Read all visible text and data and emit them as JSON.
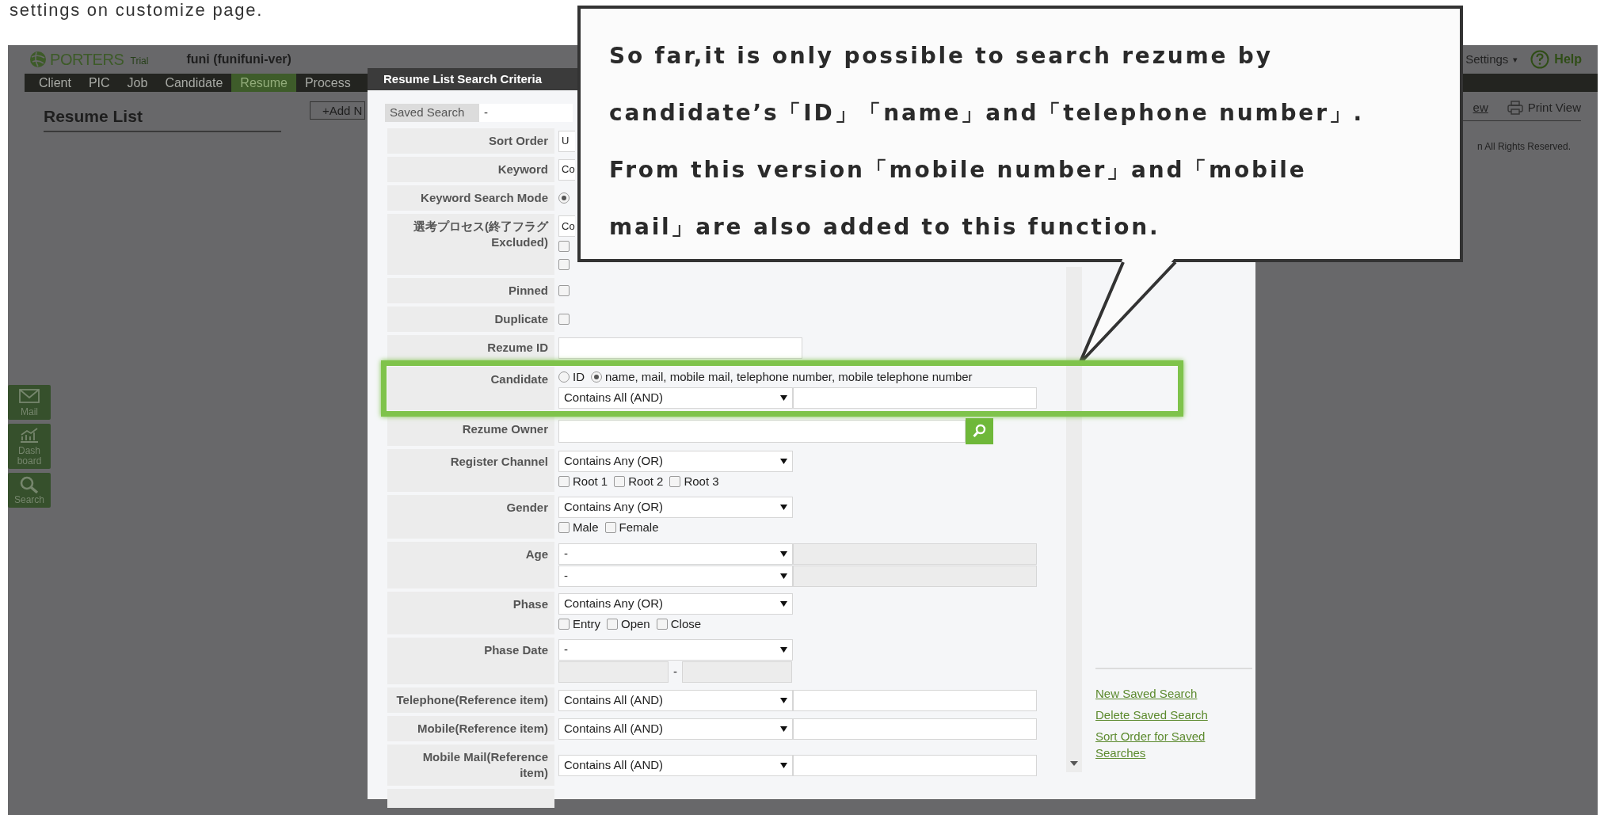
{
  "caption_top": "settings on customize page.",
  "app": {
    "logo": {
      "name": "PORTERS",
      "badge": "Trial"
    },
    "account": "funi (funifuni-ver)",
    "header_links": [
      {
        "kind": "settings",
        "label": "Settings",
        "caret": "▾"
      },
      {
        "kind": "help",
        "label": "Help"
      }
    ],
    "nav": [
      {
        "label": "Client",
        "selected": false
      },
      {
        "label": "PIC",
        "selected": false
      },
      {
        "label": "Job",
        "selected": false
      },
      {
        "label": "Candidate",
        "selected": false
      },
      {
        "label": "Resume",
        "selected": true
      },
      {
        "label": "Process",
        "selected": false
      }
    ],
    "page_title": "Resume List",
    "add_button": "+Add N",
    "view_links": [
      {
        "kind": "link",
        "label": "ew"
      },
      {
        "kind": "print",
        "label": "Print View"
      }
    ],
    "footer": "n All Rights Reserved.",
    "side_buttons": [
      {
        "kind": "mail",
        "label": "Mail"
      },
      {
        "kind": "dashboard",
        "label": "Dash\nboard"
      },
      {
        "kind": "search",
        "label": "Search"
      }
    ]
  },
  "dialog": {
    "title": "Resume List Search Criteria",
    "saved_search": {
      "label": "Saved Search",
      "value": "-"
    },
    "rows": [
      {
        "label": "Sort Order",
        "lines": [
          [
            {
              "kind": "partial_select",
              "value": "U"
            }
          ]
        ]
      },
      {
        "label": "Keyword",
        "lines": [
          [
            {
              "kind": "partial_select",
              "value": "Co"
            }
          ]
        ]
      },
      {
        "label": "Keyword Search Mode",
        "lines": [
          [
            {
              "kind": "radio",
              "selected": true
            }
          ]
        ]
      },
      {
        "label": "選考プロセス(終了フラグ Excluded)",
        "lines": [
          [
            {
              "kind": "partial_select",
              "value": "Co"
            }
          ],
          [
            {
              "kind": "checkbox",
              "checked": false
            }
          ],
          [
            {
              "kind": "checkbox",
              "checked": false
            }
          ]
        ]
      },
      {
        "label": "Pinned",
        "lines": [
          [
            {
              "kind": "checkbox",
              "checked": false
            }
          ]
        ]
      },
      {
        "label": "Duplicate",
        "lines": [
          [
            {
              "kind": "checkbox",
              "checked": false
            }
          ]
        ]
      },
      {
        "label": "Rezume ID",
        "lines": [
          [
            {
              "kind": "input",
              "disabled": false
            }
          ]
        ]
      },
      {
        "label": "Candidate",
        "highlighted": true,
        "lines": [
          [
            {
              "kind": "radio",
              "label": "ID",
              "selected": false
            },
            {
              "kind": "radio",
              "label": "name, mail, mobile mail, telephone number, mobile telephone number",
              "selected": true
            }
          ],
          [
            {
              "kind": "select",
              "value": "Contains All (AND)"
            },
            {
              "kind": "input",
              "disabled": false
            }
          ]
        ]
      },
      {
        "label": "Rezume Owner",
        "lines": [
          [
            {
              "kind": "lookup"
            }
          ]
        ]
      },
      {
        "label": "Register Channel",
        "lines": [
          [
            {
              "kind": "select",
              "value": "Contains Any (OR)"
            }
          ],
          [
            {
              "kind": "checkbox",
              "label": "Root 1",
              "checked": false
            },
            {
              "kind": "checkbox",
              "label": "Root 2",
              "checked": false
            },
            {
              "kind": "checkbox",
              "label": "Root 3",
              "checked": false
            }
          ]
        ]
      },
      {
        "label": "Gender",
        "lines": [
          [
            {
              "kind": "select",
              "value": "Contains Any (OR)"
            }
          ],
          [
            {
              "kind": "checkbox",
              "label": "Male",
              "checked": false
            },
            {
              "kind": "checkbox",
              "label": "Female",
              "checked": false
            }
          ]
        ]
      },
      {
        "label": "Age",
        "lines": [
          [
            {
              "kind": "select",
              "value": "-"
            },
            {
              "kind": "input",
              "disabled": true
            }
          ],
          [
            {
              "kind": "select",
              "value": "-"
            },
            {
              "kind": "input",
              "disabled": true
            }
          ]
        ]
      },
      {
        "label": "Phase",
        "lines": [
          [
            {
              "kind": "select",
              "value": "Contains Any (OR)"
            }
          ],
          [
            {
              "kind": "checkbox",
              "label": "Entry",
              "checked": false
            },
            {
              "kind": "checkbox",
              "label": "Open",
              "checked": false
            },
            {
              "kind": "checkbox",
              "label": "Close",
              "checked": false
            }
          ]
        ]
      },
      {
        "label": "Phase Date",
        "lines": [
          [
            {
              "kind": "select",
              "value": "-"
            }
          ],
          [
            {
              "kind": "short_input",
              "disabled": true
            },
            {
              "kind": "dash",
              "text": "-"
            },
            {
              "kind": "short_input",
              "disabled": true
            }
          ]
        ]
      },
      {
        "label": "Telephone(Reference item)",
        "lines": [
          [
            {
              "kind": "select",
              "value": "Contains All (AND)"
            },
            {
              "kind": "input",
              "disabled": false
            }
          ]
        ]
      },
      {
        "label": "Mobile(Reference item)",
        "lines": [
          [
            {
              "kind": "select",
              "value": "Contains All (AND)"
            },
            {
              "kind": "input",
              "disabled": false
            }
          ]
        ]
      },
      {
        "label": "Mobile Mail(Reference item)",
        "lines": [
          [
            {
              "kind": "select",
              "value": "Contains All (AND)"
            },
            {
              "kind": "input",
              "disabled": false
            }
          ]
        ]
      }
    ],
    "links": [
      "New Saved Search",
      "Delete Saved Search",
      "Sort Order for Saved Searches"
    ]
  },
  "callout": {
    "text": "So far,it is only possible to search rezume by\ncandidate’s「ID」「name」and「telephone number」.\nFrom this version「mobile number」and「mobile\nmail」are also added to this function."
  }
}
